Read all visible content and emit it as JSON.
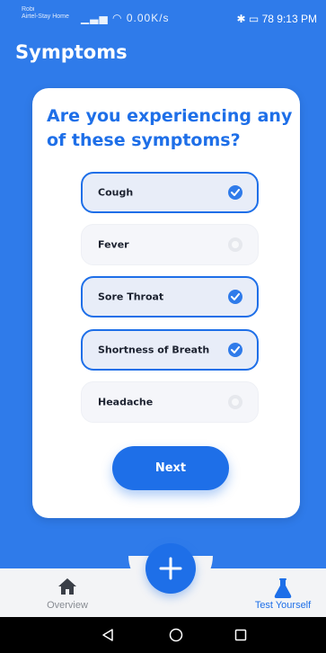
{
  "status_bar": {
    "carrier_primary": "Robi",
    "carrier_secondary": "Airtel-Stay Home",
    "network_speed": "0.00K/s",
    "battery": "78",
    "time": "9:13 PM"
  },
  "header": {
    "title": "Symptoms"
  },
  "card": {
    "question": "Are you experiencing any of these symptoms?",
    "options": [
      {
        "label": "Cough",
        "selected": true
      },
      {
        "label": "Fever",
        "selected": false
      },
      {
        "label": "Sore Throat",
        "selected": true
      },
      {
        "label": "Shortness of Breath",
        "selected": true
      },
      {
        "label": "Headache",
        "selected": false
      }
    ],
    "next_label": "Next"
  },
  "bottom_nav": {
    "overview_label": "Overview",
    "test_label": "Test Yourself",
    "active_tab": "Test Yourself",
    "fab_icon": "plus-icon"
  },
  "icons": {
    "overview": "home-icon",
    "test": "flask-icon",
    "option_selected": "check-circle-icon",
    "option_unselected": "radio-empty-icon"
  },
  "colors": {
    "background": "#2F7BEA",
    "accent": "#1E6FE8",
    "card": "#FFFFFF",
    "nav_background": "#F3F4F6"
  }
}
